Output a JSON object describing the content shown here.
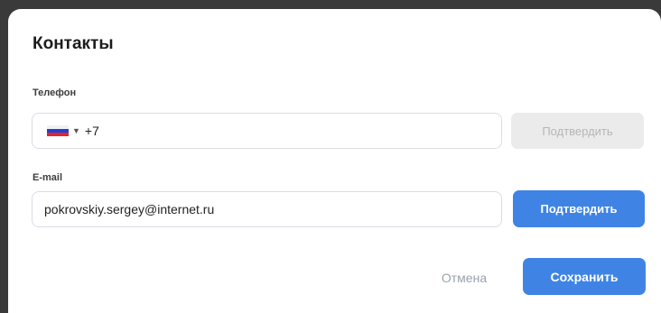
{
  "dialog": {
    "title": "Контакты"
  },
  "phone": {
    "label": "Телефон",
    "country_code": "+7",
    "value": "",
    "confirm_label": "Подтвердить",
    "confirm_enabled": false
  },
  "email": {
    "label": "E-mail",
    "value": "pokrovskiy.sergey@internet.ru",
    "confirm_label": "Подтвердить",
    "confirm_enabled": true
  },
  "actions": {
    "cancel_label": "Отмена",
    "save_label": "Сохранить"
  },
  "colors": {
    "primary": "#3f84e5",
    "disabled_bg": "#ebebeb",
    "disabled_text": "#b6b6b6",
    "muted_text": "#9aa2ad",
    "border": "#d9dde3"
  },
  "icons": {
    "flag": "russia-flag-icon",
    "caret": "caret-down-icon"
  }
}
